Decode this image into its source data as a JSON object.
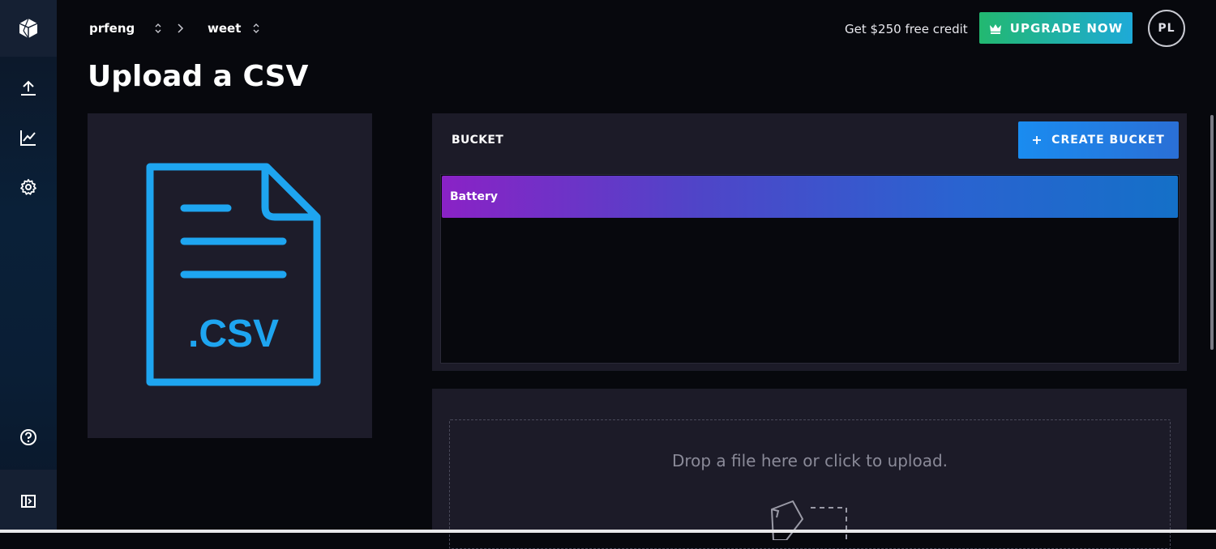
{
  "breadcrumb": {
    "org": "prfeng",
    "bucket": "weet"
  },
  "header": {
    "credit_text": "Get $250 free credit",
    "upgrade_label": "UPGRADE NOW",
    "avatar_initials": "PL"
  },
  "page": {
    "title": "Upload a CSV"
  },
  "csv_icon": {
    "text": ".CSV",
    "color": "#1ea5f0"
  },
  "bucket_section": {
    "label": "BUCKET",
    "create_label": "CREATE BUCKET",
    "items": [
      "Battery"
    ]
  },
  "upload": {
    "drop_text": "Drop a file here or click to upload."
  },
  "sidebar": {
    "items": [
      {
        "icon": "upload-icon"
      },
      {
        "icon": "chart-icon"
      },
      {
        "icon": "gear-icon"
      },
      {
        "icon": "help-icon"
      },
      {
        "icon": "collapse-icon"
      }
    ]
  }
}
